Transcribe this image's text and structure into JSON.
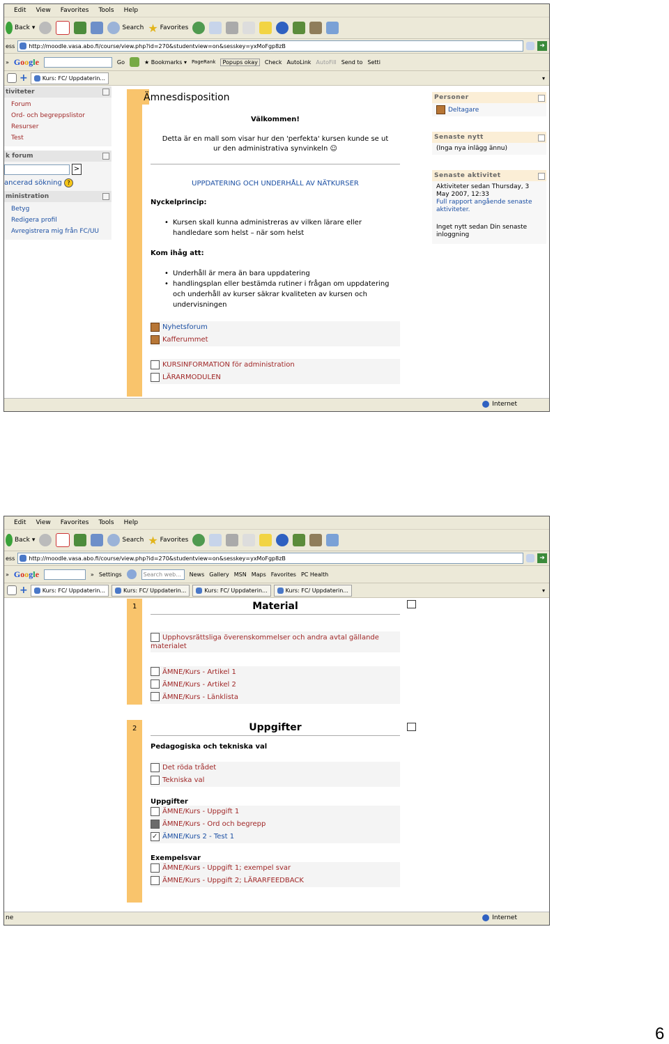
{
  "browser": {
    "menu": [
      "Edit",
      "View",
      "Favorites",
      "Tools",
      "Help"
    ],
    "back_label": "Back",
    "search_label": "Search",
    "favorites_label": "Favorites",
    "address_label": "ess",
    "url": "http://moodle.vasa.abo.fi/course/view.php?id=270&studentview=on&sesskey=yxMoFgp8zB",
    "status_zone": "Internet"
  },
  "shot1": {
    "gbar": [
      "Go",
      "Bookmarks",
      "PageRank",
      "Popups okay",
      "Check",
      "AutoLink",
      "AutoFill",
      "Send to",
      "Setti"
    ],
    "tab": "Kurs: FC/ Uppdaterin...",
    "left": {
      "activities_title": "tiviteter",
      "activities": [
        "Forum",
        "Ord- och begreppslistor",
        "Resurser",
        "Test"
      ],
      "forum_title": "k forum",
      "search_go": ">",
      "advanced_search": "ancerad sökning",
      "admin_title": "ministration",
      "admin_items": [
        "Betyg",
        "Redigera profil",
        "Avregistrera mig från FC/UU"
      ]
    },
    "main": {
      "title": "Ämnesdisposition",
      "welcome": "Välkommen!",
      "intro_1": "Detta är en mall som visar hur den 'perfekta' kursen kunde se ut",
      "intro_2": "ur den administrativa synvinkeln",
      "heading": "UPPDATERING OCH UNDERHÅLL AV NÄTKURSER",
      "key_title": "Nyckelprincip:",
      "key_1": "Kursen skall kunna administreras av vilken lärare eller",
      "key_2": "handledare som helst – när som helst",
      "remember_title": "Kom ihåg att:",
      "rem_1": "Underhåll är mera än bara uppdatering",
      "rem_2a": "handlingsplan eller bestämda rutiner i frågan om uppdatering",
      "rem_2b": "och underhåll av kurser säkrar kvaliteten av kursen och",
      "rem_2c": "undervisningen",
      "forum_1": "Nyhetsforum",
      "forum_2": "Kafferummet",
      "res_1": "KURSINFORMATION för administration",
      "res_2": "LÄRARMODULEN"
    },
    "right": {
      "persons_title": "Personer",
      "participants": "Deltagare",
      "news_title": "Senaste nytt",
      "news_empty": "(Inga nya inlägg ännu)",
      "activity_title": "Senaste aktivitet",
      "activity_1": "Aktiviteter sedan Thursday, 3",
      "activity_2": "May 2007, 12:33",
      "report_1": "Full rapport angående senaste",
      "report_2": "aktiviteter.",
      "nothing_1": "Inget nytt sedan Din senaste",
      "nothing_2": "inloggning"
    }
  },
  "shot2": {
    "gbar": [
      "Settings",
      "Search web...",
      "News",
      "Gallery",
      "MSN",
      "Maps",
      "Favorites",
      "PC Health"
    ],
    "tabs": [
      "Kurs: FC/ Uppdaterin...",
      "Kurs: FC/ Uppdaterin...",
      "Kurs: FC/ Uppdaterin...",
      "Kurs: FC/ Uppdaterin..."
    ],
    "sec1": {
      "num": "1",
      "title": "Material",
      "item_1a": "Upphovsrättsliga överenskommelser och andra avtal gällande",
      "item_1b": "materialet",
      "item_2": "ÄMNE/Kurs - Artikel 1",
      "item_3": "ÄMNE/Kurs - Artikel 2",
      "item_4": "ÄMNE/Kurs - Länklista"
    },
    "sec2": {
      "num": "2",
      "title": "Uppgifter",
      "sub_1": "Pedagogiska och tekniska val",
      "link_1": "Det röda trådet",
      "link_2": "Tekniska val",
      "sub_2": "Uppgifter",
      "link_3": "ÄMNE/Kurs - Uppgift 1",
      "link_4": "ÄMNE/Kurs - Ord och begrepp",
      "link_5": "ÄMNE/Kurs 2 - Test 1",
      "sub_3": "Exempelsvar",
      "link_6": "ÄMNE/Kurs - Uppgift 1; exempel svar",
      "link_7": "ÄMNE/Kurs - Uppgift 2; LÄRARFEEDBACK"
    },
    "status_left": "ne"
  },
  "page_number": "6"
}
